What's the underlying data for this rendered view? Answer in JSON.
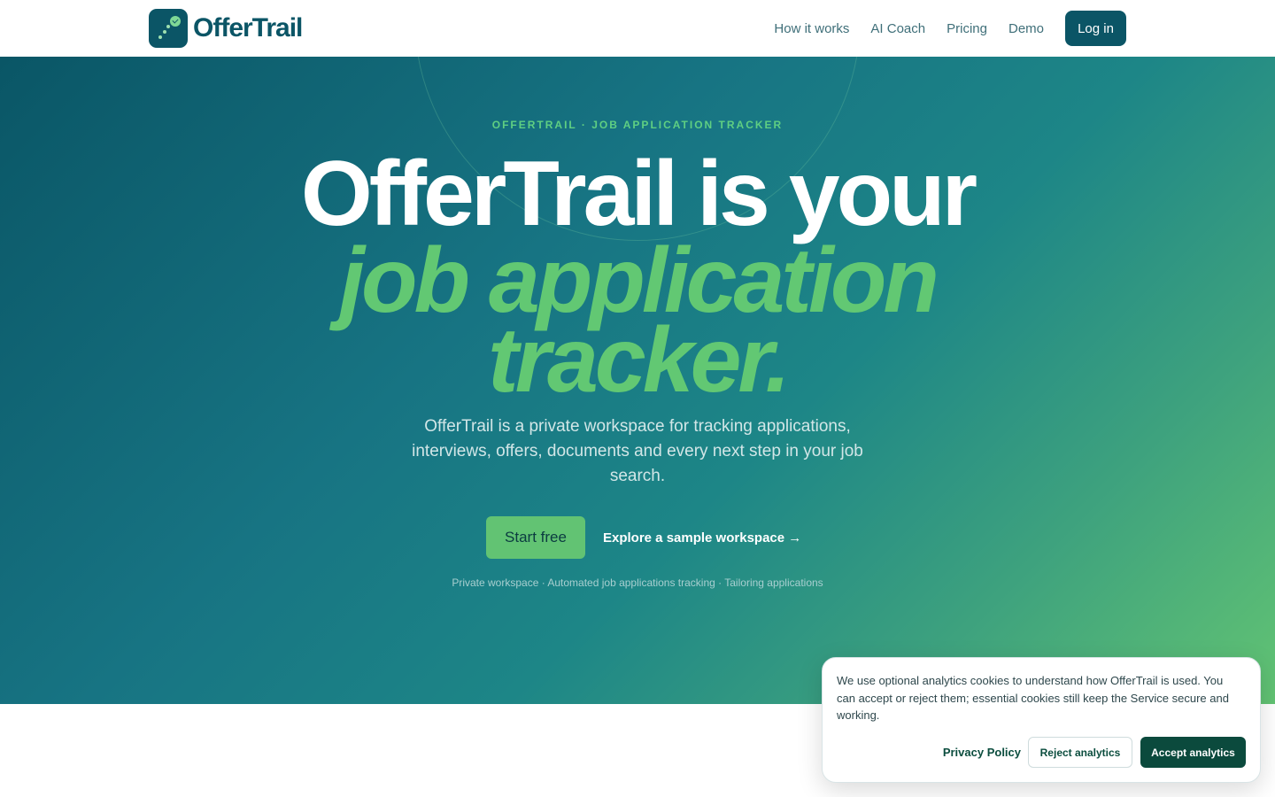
{
  "brand": {
    "name": "OfferTrail",
    "logo_icon": "trail-check-icon"
  },
  "nav": {
    "links": [
      "How it works",
      "AI Coach",
      "Pricing",
      "Demo"
    ],
    "login_label": "Log in"
  },
  "hero": {
    "eyebrow": "OFFERTRAIL · JOB APPLICATION TRACKER",
    "headline_line1": "OfferTrail is your",
    "headline_line2": "job application",
    "headline_line3": "tracker.",
    "subtitle": "OfferTrail is a private workspace for tracking applications, interviews, offers, documents and every next step in your job search.",
    "primary_cta": "Start free",
    "secondary_cta": "Explore a sample workspace →",
    "features": "Private workspace · Automated job applications tracking · Tailoring applications"
  },
  "cookie_banner": {
    "text": "We use optional analytics cookies to understand how OfferTrail is used. You can accept or reject them; essential cookies still keep the Service secure and working.",
    "privacy_label": "Privacy Policy",
    "reject_label": "Reject analytics",
    "accept_label": "Accept analytics"
  },
  "colors": {
    "brand_dark": "#0b5566",
    "accent_green": "#62c373",
    "hero_gradient_start": "#0a5666",
    "hero_gradient_end": "#62c373",
    "accept_button": "#0b4a3d"
  }
}
